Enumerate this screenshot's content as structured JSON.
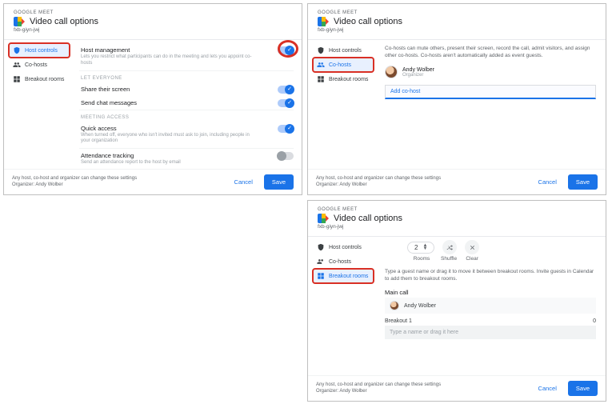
{
  "common": {
    "app": "GOOGLE MEET",
    "title": "Video call options",
    "code": "fxb-giyn-jwj",
    "nav": {
      "host": "Host controls",
      "cohosts": "Co-hosts",
      "breakout": "Breakout rooms"
    },
    "footer_note": "Any host, co-host and organizer can change these settings",
    "organizer_line": "Organizer: Andy Wolber",
    "cancel": "Cancel",
    "save": "Save"
  },
  "panel1": {
    "hm_title": "Host management",
    "hm_sub": "Lets you restrict what participants can do in the meeting and lets you appoint co-hosts",
    "let_header": "LET EVERYONE",
    "share": "Share their screen",
    "chat": "Send chat messages",
    "access_header": "MEETING ACCESS",
    "qa_title": "Quick access",
    "qa_sub": "When turned off, everyone who isn't invited must ask to join, including people in your organization",
    "at_title": "Attendance tracking",
    "at_sub": "Send an attendance report to the host by email"
  },
  "panel2": {
    "intro": "Co-hosts can mute others, present their screen, record the call, admit visitors, and assign other co-hosts. Co-hosts aren't automatically added as event guests.",
    "name": "Andy Wolber",
    "role": "Organizer",
    "add": "Add co-host"
  },
  "panel3": {
    "count": "2",
    "rooms": "Rooms",
    "shuffle": "Shuffle",
    "clear": "Clear",
    "intro": "Type a guest name or drag it to move it between breakout rooms. Invite guests in Calendar to add them to breakout rooms.",
    "main_call": "Main call",
    "name": "Andy Wolber",
    "b1": "Breakout 1",
    "b1_count": "0",
    "placeholder": "Type a name or drag it here"
  }
}
